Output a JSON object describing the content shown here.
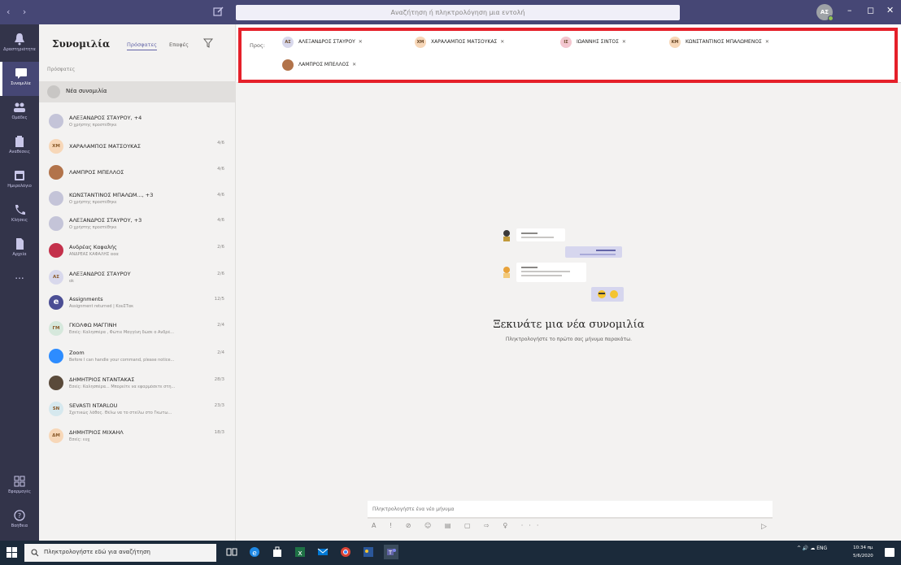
{
  "titlebar": {
    "search_placeholder": "Αναζήτηση ή πληκτρολόγηση μια εντολή",
    "user_initials": "AΣ",
    "minimize": "–",
    "maximize": "◻",
    "close": "✕"
  },
  "rail": {
    "items": [
      {
        "label": "Δραστηριότητα",
        "icon": "bell-icon"
      },
      {
        "label": "Συνομιλία",
        "icon": "chat-icon"
      },
      {
        "label": "Ομάδες",
        "icon": "teams-icon"
      },
      {
        "label": "Αναθέσεις",
        "icon": "assignments-icon"
      },
      {
        "label": "Ημερολόγιο",
        "icon": "calendar-icon"
      },
      {
        "label": "Κλήσεις",
        "icon": "phone-icon"
      },
      {
        "label": "Αρχεία",
        "icon": "files-icon"
      },
      {
        "label": "...",
        "icon": "more-icon"
      }
    ],
    "bottom": [
      {
        "label": "Εφαρμογές",
        "icon": "apps-icon"
      },
      {
        "label": "Βοήθεια",
        "icon": "help-icon"
      }
    ]
  },
  "list": {
    "title": "Συνομιλία",
    "tab_recent": "Πρόσφατες",
    "tab_contacts": "Επαφές",
    "recent_label": "Πρόσφατες",
    "new_chat": "Νέα συνομιλία",
    "rows": [
      {
        "name": "ΑΛΕΞΑΝΔΡΟΣ ΣΤΑΥΡΟΥ, +4",
        "preview": "Ο χρήστης προστέθηκε",
        "time": "",
        "avatar": "group",
        "color": "#c4c4d8"
      },
      {
        "name": "ΧΑΡΑΛΑΜΠΟΣ ΜΑΤΣΟΥΚΑΣ",
        "preview": "",
        "time": "4/6",
        "avatar": "ΧΜ",
        "color": "#f7d7b8"
      },
      {
        "name": "ΛΑΜΠΡΟΣ ΜΠΕΛΛΟΣ",
        "preview": "",
        "time": "4/6",
        "avatar": "photo",
        "color": "#b2734a"
      },
      {
        "name": "ΚΩΝΣΤΑΝΤΙΝΟΣ ΜΠΑΛΩΜ..., +3",
        "preview": "Ο χρήστης προστέθηκε",
        "time": "4/6",
        "avatar": "group",
        "color": "#c4c4d8"
      },
      {
        "name": "ΑΛΕΞΑΝΔΡΟΣ ΣΤΑΥΡΟΥ, +3",
        "preview": "Ο χρήστης προστέθηκε",
        "time": "4/6",
        "avatar": "group",
        "color": "#c4c4d8"
      },
      {
        "name": "Ανδρέας Καφαλής",
        "preview": "ΑΝΔΡΕΑΣ ΚΑΦΑΛΗΣ ααα",
        "time": "2/6",
        "avatar": "photo",
        "color": "#c4314b"
      },
      {
        "name": "ΑΛΕΞΑΝΔΡΟΣ ΣΤΑΥΡΟΥ",
        "preview": "ok",
        "time": "2/6",
        "avatar": "ΑΣ",
        "color": "#d8d8ec"
      },
      {
        "name": "Assignments",
        "preview": "Assignment returned | ΚουΣΤακ",
        "time": "12/5",
        "avatar": "e",
        "color": "#4b4e94"
      },
      {
        "name": "ΓΚΟΛΦΩ ΜΑΓΓΙΝΗ",
        "preview": "Εσείς: Καλησπέρα , Φώτιε Μαγγίνη δώσε ο Ανδρέ...",
        "time": "2/4",
        "avatar": "ΓΜ",
        "color": "#d6e8dc"
      },
      {
        "name": "Zoom",
        "preview": "Before I can handle your command, please notice...",
        "time": "2/4",
        "avatar": "zoom",
        "color": "#2d8cff"
      },
      {
        "name": "ΔΗΜΗΤΡΙΟΣ ΝΤΑΝΤΑΚΑΣ",
        "preview": "Εσείς: Καλησπέρα... Μπορείτε να εφαρμόσετε στη...",
        "time": "28/3",
        "avatar": "photo",
        "color": "#5a4a3a"
      },
      {
        "name": "SEVASTI NTARLOU",
        "preview": "Σχετικώς λάθος. Θέλω να το στείλω στο Γκωτω...",
        "time": "23/3",
        "avatar": "SN",
        "color": "#d6e8ee"
      },
      {
        "name": "ΔΗΜΗΤΡΙΟΣ ΜΙΧΑΗΛ",
        "preview": "Εσείς: ευχ",
        "time": "18/3",
        "avatar": "ΔΜ",
        "color": "#f7d7b8"
      }
    ]
  },
  "main": {
    "to_label": "Προς:",
    "recipients": [
      {
        "initials": "ΑΣ",
        "name": "ΑΛΕΞΑΝΔΡΟΣ ΣΤΑΥΡΟΥ",
        "color": "#d8d8ec"
      },
      {
        "initials": "ΧΜ",
        "name": "ΧΑΡΑΛΑΜΠΟΣ ΜΑΤΣΟΥΚΑΣ",
        "color": "#f7d7b8"
      },
      {
        "initials": "ΙΣ",
        "name": "ΙΩΑΝΝΗΣ ΣΙΝΤΟΣ",
        "color": "#f3c6cf"
      },
      {
        "initials": "ΚΜ",
        "name": "ΚΩΝΣΤΑΝΤΙΝΟΣ ΜΠΑΛΩΜΕΝΟΣ",
        "color": "#f7d7b8"
      },
      {
        "initials": "",
        "name": "ΛΑΜΠΡΟΣ ΜΠΕΛΛΟΣ",
        "color": "#b2734a"
      }
    ],
    "empty_title": "Ξεκινάτε μια νέα συνομιλία",
    "empty_sub": "Πληκτρολογήστε το πρώτο σας μήνυμα παρακάτω.",
    "composer_placeholder": "Πληκτρολογήστε ένα νέο μήνυμα",
    "tools": "A ! ⊘ ☺ ▤ ▢ ⇨ ♀ ···",
    "send": "▷"
  },
  "taskbar": {
    "search_placeholder": "Πληκτρολογήστε εδώ για αναζήτηση",
    "tray": "^ 🔊 ☁ ENG",
    "time": "10:34 πμ",
    "date": "5/6/2020"
  },
  "colors": {
    "teams_purple": "#464775",
    "rail_bg": "#33344a",
    "highlight_red": "#e5202a",
    "taskbar_bg": "#1b2a3a"
  }
}
